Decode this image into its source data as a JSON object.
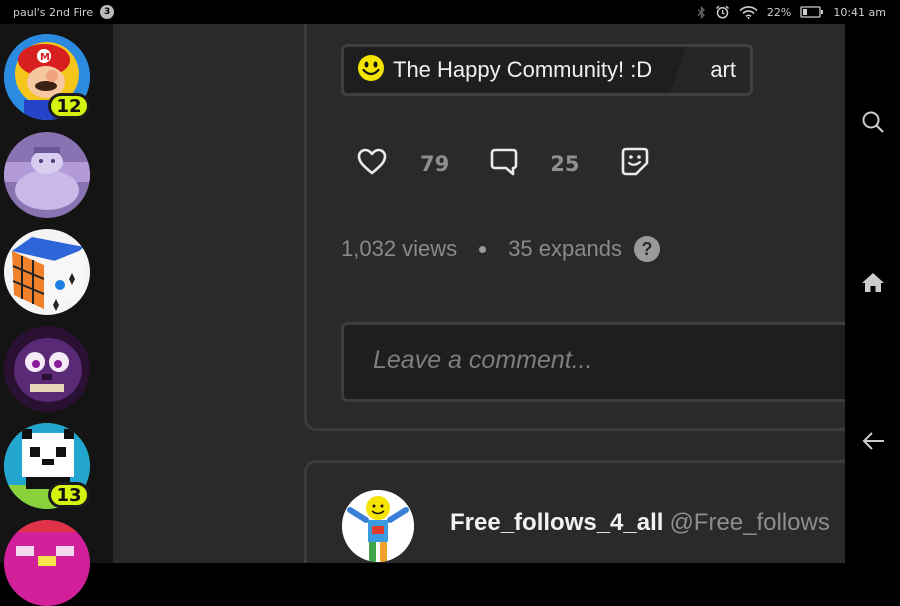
{
  "status_bar": {
    "device_name": "paul's 2nd Fire",
    "notification_count": "3",
    "battery": "22%",
    "time": "10:41 am",
    "icons": [
      "bluetooth-icon",
      "alarm-icon",
      "wifi-icon",
      "battery-icon"
    ]
  },
  "sidebar": {
    "chats": [
      {
        "name": "mario-avatar",
        "badge": "12"
      },
      {
        "name": "purple-creature-avatar",
        "badge": ""
      },
      {
        "name": "rubiks-cube-avatar",
        "badge": ""
      },
      {
        "name": "purple-animatronic-avatar",
        "badge": ""
      },
      {
        "name": "pixel-panda-avatar",
        "badge": "13"
      },
      {
        "name": "pink-character-avatar",
        "badge": ""
      }
    ]
  },
  "post": {
    "community_name": "The Happy Community! :D",
    "community_tag": "art",
    "likes": "79",
    "comments": "25",
    "views": "1,032 views",
    "expands": "35 expands",
    "comment_placeholder": "Leave a comment..."
  },
  "next_post": {
    "username": "Free_follows_4_all",
    "handle": "@Free_follows"
  },
  "colors": {
    "badge": "#d6f30f",
    "background": "#2a2a2a",
    "rail": "#141414",
    "smiley": "#f5e400"
  },
  "nav_icons": [
    "search-icon",
    "home-icon",
    "back-arrow-icon"
  ]
}
